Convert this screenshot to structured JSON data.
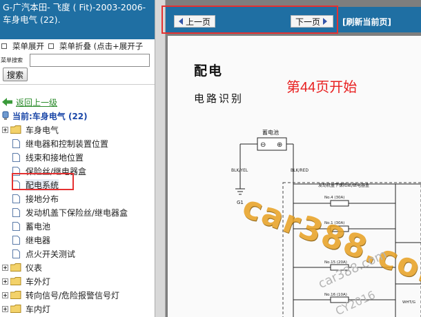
{
  "left_panel": {
    "header_title": "G-广汽本田- 飞度 ( Fit)-2003-2006- 车身电气 (22).",
    "menu_expand": "菜单展开",
    "menu_collapse": "菜单折叠 (点击+展开子",
    "search_label": "菜单搜索",
    "search_value": "",
    "search_button": "搜索",
    "back_link": "返回上一级",
    "current": "当前:车身电气 (22)",
    "tree": [
      {
        "label": "车身电气",
        "type": "folder"
      },
      {
        "label": "继电器和控制装置位置",
        "type": "doc"
      },
      {
        "label": "线束和接地位置",
        "type": "doc"
      },
      {
        "label": "保险丝/继电器盒",
        "type": "doc"
      },
      {
        "label": "配电系统",
        "type": "doc",
        "selected": true
      },
      {
        "label": "接地分布",
        "type": "doc"
      },
      {
        "label": "发动机盖下保险丝/继电器盒",
        "type": "doc"
      },
      {
        "label": "蓄电池",
        "type": "doc"
      },
      {
        "label": "继电器",
        "type": "doc"
      },
      {
        "label": "点火开关测试",
        "type": "doc"
      },
      {
        "label": "仪表",
        "type": "folder"
      },
      {
        "label": "车外灯",
        "type": "folder"
      },
      {
        "label": "转向信号/危险报警信号灯",
        "type": "folder"
      },
      {
        "label": "车内灯",
        "type": "folder"
      }
    ]
  },
  "right_panel": {
    "prev_button": "上一页",
    "next_button": "下一页",
    "refresh_link": "[刷新当前页]",
    "page_title": "配电",
    "page_subtitle": "电路识别",
    "page_note": "第44页开始",
    "diagram_labels": {
      "battery": "蓄电池",
      "blk_yel": "BLK/YEL",
      "blk_red": "BLK/RED",
      "ground": "G1",
      "fuse_box": "发动机盖下保险丝/继电器盒",
      "fuse_4": "No.4 (30A)",
      "fuse_1": "No.1 (30A)",
      "fuse_15": "No.15 (20A)",
      "fuse_16": "No.16 (10A)",
      "wht_g": "WHT/G"
    },
    "watermark_big": "car388.com",
    "watermark_small": "car388.com",
    "watermark_small2": "CY2016"
  },
  "colors": {
    "header_blue": "#1f6fa3",
    "highlight_red": "#e53030",
    "link_green": "#2a8a2a",
    "current_blue": "#1b47a8",
    "note_red": "#e82020",
    "watermark_orange": "#e8a020"
  }
}
